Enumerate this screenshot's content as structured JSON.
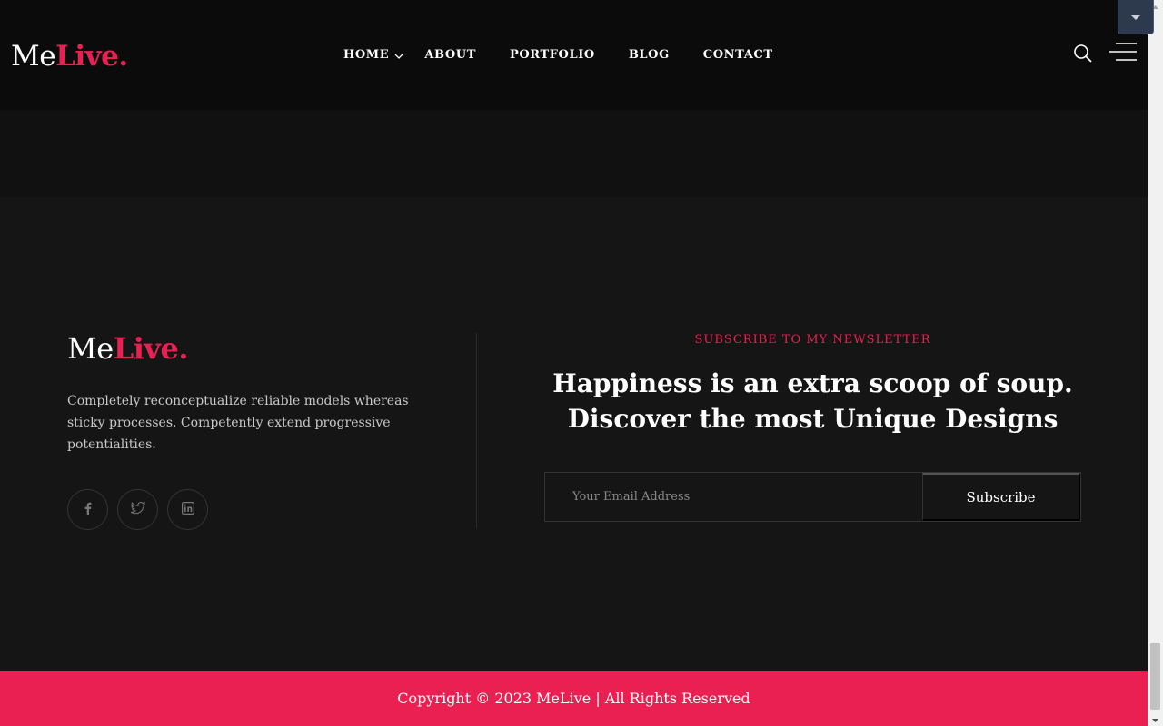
{
  "header": {
    "logo": {
      "part1": "Me",
      "part2": "Live."
    },
    "nav": [
      {
        "label": "HOME"
      },
      {
        "label": "ABOUT"
      },
      {
        "label": "PORTFOLIO"
      },
      {
        "label": "BLOG"
      },
      {
        "label": "CONTACT"
      }
    ],
    "search_icon": "search-icon",
    "menu_icon": "hamburger-menu-icon"
  },
  "footer": {
    "logo": {
      "part1": "Me",
      "part2": "Live."
    },
    "about": "Completely reconceptualize reliable models whereas sticky processes. Competently extend progressive potentialities.",
    "socials": [
      {
        "icon": "facebook-icon"
      },
      {
        "icon": "twitter-icon"
      },
      {
        "icon": "linkedin-icon"
      }
    ],
    "newsletter": {
      "eyebrow": "SUBSCRIBE TO MY NEWSLETTER",
      "headline_line1": "Happiness is an extra scoop of soup.",
      "headline_line2": "Discover the most Unique Designs",
      "email_placeholder": "Your Email Address",
      "button_label": "Subscribe"
    }
  },
  "copyright": "Copyright © 2023 MeLive | All Rights Reserved",
  "colors": {
    "accent": "#ea2052",
    "header_bg": "#0b0b0b",
    "footer_bg": "#151515"
  },
  "floating_toggle": {
    "icon": "caret-down-icon"
  }
}
